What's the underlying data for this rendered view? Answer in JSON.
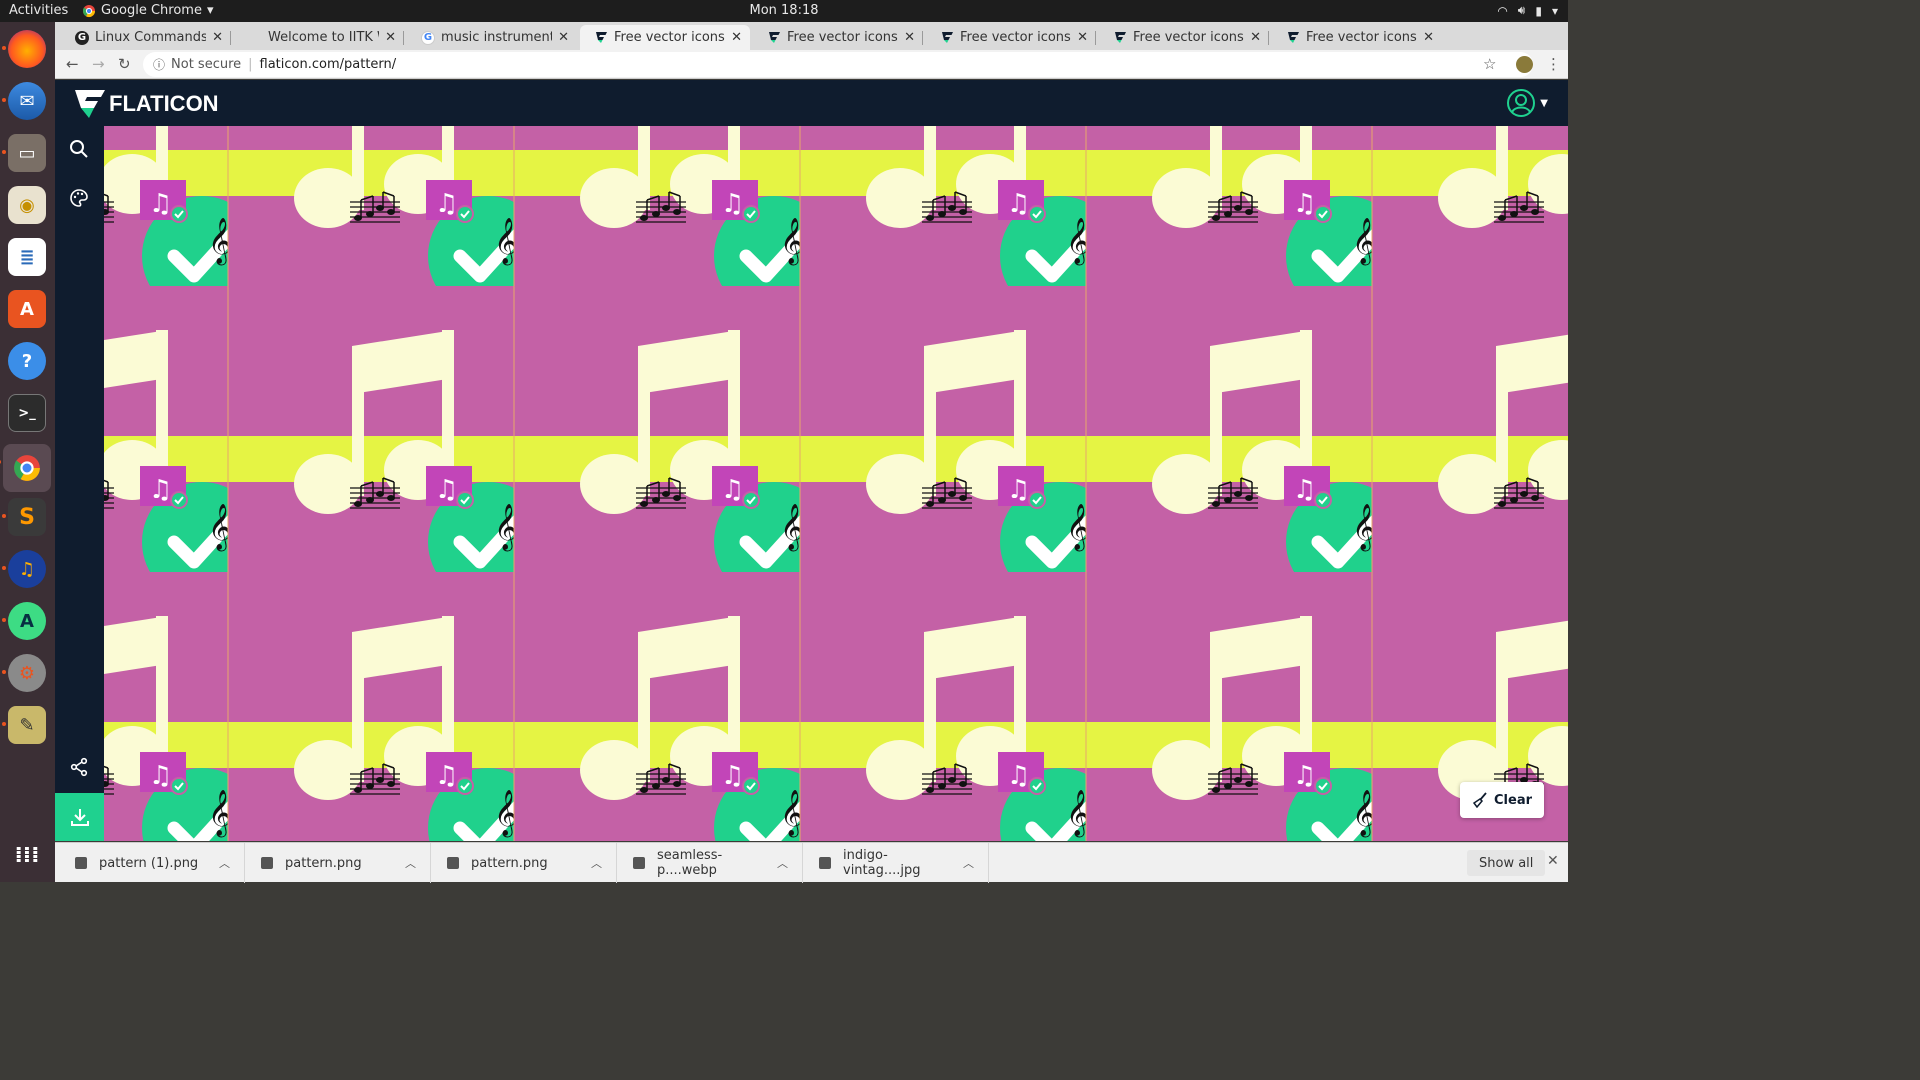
{
  "system": {
    "activities": "Activities",
    "app_name": "Google Chrome",
    "clock": "Mon 18:18"
  },
  "tabs": [
    {
      "title": "Linux Commands Che",
      "favicon": "G"
    },
    {
      "title": "Welcome to IITK Webr",
      "favicon": ""
    },
    {
      "title": "music instruments im",
      "favicon": "G"
    },
    {
      "title": "Free vector icons - SV",
      "favicon": "flaticon",
      "active": true
    },
    {
      "title": "Free vector icons - SV",
      "favicon": "flaticon"
    },
    {
      "title": "Free vector icons - SV",
      "favicon": "flaticon"
    },
    {
      "title": "Free vector icons - SV",
      "favicon": "flaticon"
    },
    {
      "title": "Free vector icons - SV",
      "favicon": "flaticon"
    }
  ],
  "address": {
    "security": "Not secure",
    "url": "flaticon.com/pattern/"
  },
  "flaticon": {
    "logo": "FLATICON",
    "clear_label": "Clear"
  },
  "colors": {
    "pattern_bg": "#c461a6",
    "pattern_band": "#e5f444",
    "note": "#fbfbd5",
    "badge_green": "#20d18c",
    "header_bg": "#0f1c2e"
  },
  "downloads": [
    {
      "name": "pattern (1).png"
    },
    {
      "name": "pattern.png"
    },
    {
      "name": "pattern.png"
    },
    {
      "name": "seamless-p....webp"
    },
    {
      "name": "indigo-vintag....jpg"
    }
  ],
  "downloads_show_all": "Show all",
  "dock_icons": [
    "firefox-icon",
    "thunderbird-icon",
    "files-icon",
    "rhythmbox-icon",
    "writer-icon",
    "software-center-icon",
    "help-icon",
    "terminal-icon",
    "chrome-icon",
    "sublime-text-icon",
    "audacity-icon",
    "android-studio-icon",
    "settings-tool-icon",
    "screenshot-icon",
    "app-grid-icon"
  ]
}
